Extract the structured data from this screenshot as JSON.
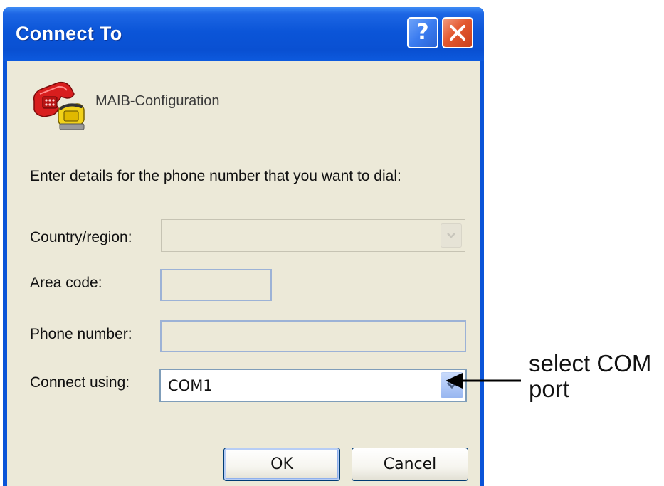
{
  "window": {
    "title": "Connect To"
  },
  "titlebar_buttons": {
    "help_label": "?",
    "close_icon": "close-icon"
  },
  "connection": {
    "name": "MAIB-Configuration",
    "icon": "phone-icon"
  },
  "instruction": "Enter details for the phone number that you want to dial:",
  "fields": {
    "country_label": "Country/region:",
    "country_value": "",
    "area_label": "Area code:",
    "area_value": "",
    "phone_label": "Phone number:",
    "phone_value": "",
    "connect_label": "Connect using:",
    "connect_value": "COM1"
  },
  "buttons": {
    "ok": "OK",
    "cancel": "Cancel"
  },
  "annotation": {
    "line1": "select COM",
    "line2": "port"
  },
  "colors": {
    "titlebar": "#0a54d8",
    "client_bg": "#ece9d8",
    "close_button": "#e3582f",
    "help_button": "#3b7cf0"
  }
}
